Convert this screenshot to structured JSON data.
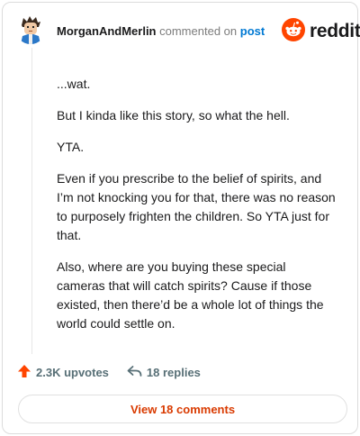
{
  "header": {
    "username": "MorganAndMerlin",
    "action": "commented on",
    "post_link": "post",
    "logo_text": "reddit"
  },
  "comment": {
    "paragraphs": [
      "...wat.",
      "But I kinda like this story, so what the hell.",
      "YTA.",
      "Even if you prescribe to the belief of spirits, and I’m not knocking you for that, there was no reason to purposely frighten the children. So YTA just for that.",
      "Also, where are you buying these special cameras that will catch spirits? Cause if those existed, then there’d be a whole lot of things the world could settle on."
    ]
  },
  "stats": {
    "upvotes": "2.3K upvotes",
    "replies": "18 replies"
  },
  "footer": {
    "view_comments": "View 18 comments"
  },
  "icons": {
    "avatar": "avatar",
    "logo": "reddit-logo-icon",
    "upvote": "upvote-arrow-icon",
    "reply": "reply-arrow-icon"
  },
  "colors": {
    "brand": "#ff4500",
    "link": "#0079d3",
    "view_button_text": "#d93a00",
    "muted": "#576f76"
  }
}
